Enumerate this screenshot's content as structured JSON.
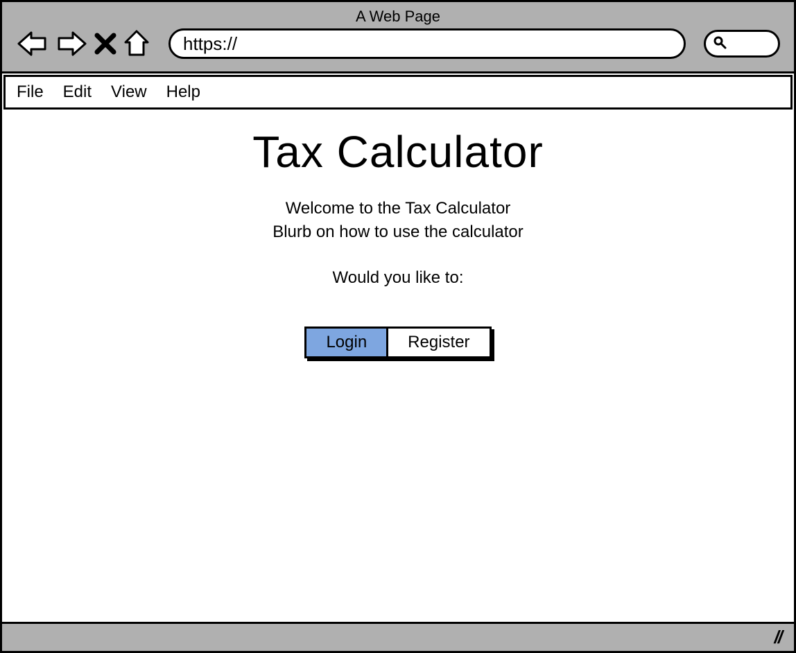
{
  "browser": {
    "title": "A Web Page",
    "url": "https://"
  },
  "menu": {
    "items": [
      "File",
      "Edit",
      "View",
      "Help"
    ]
  },
  "main": {
    "heading": "Tax Calculator",
    "welcome_line1": "Welcome to the Tax Calculator",
    "welcome_line2": "Blurb on how to use the calculator",
    "prompt": "Would you like to:",
    "buttons": {
      "login": "Login",
      "register": "Register"
    }
  }
}
